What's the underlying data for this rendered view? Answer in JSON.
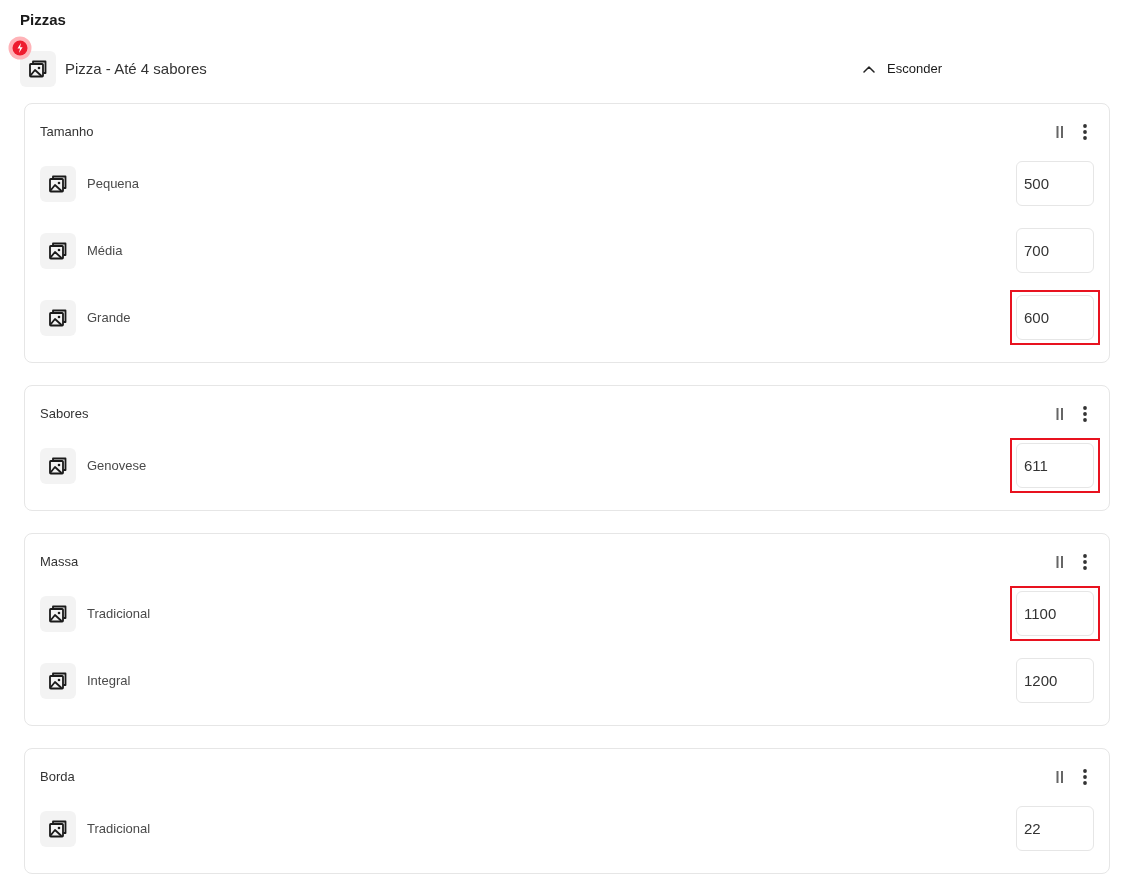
{
  "title": "Pizzas",
  "product": {
    "name": "Pizza - Até 4 sabores"
  },
  "toggle": {
    "label": "Esconder",
    "expanded": true
  },
  "sections": [
    {
      "title": "Tamanho",
      "options": [
        {
          "name": "Pequena",
          "value": "500",
          "highlighted": false
        },
        {
          "name": "Média",
          "value": "700",
          "highlighted": false
        },
        {
          "name": "Grande",
          "value": "600",
          "highlighted": true
        }
      ]
    },
    {
      "title": "Sabores",
      "options": [
        {
          "name": "Genovese",
          "value": "611",
          "highlighted": true
        }
      ]
    },
    {
      "title": "Massa",
      "options": [
        {
          "name": "Tradicional",
          "value": "1100",
          "highlighted": true
        },
        {
          "name": "Integral",
          "value": "1200",
          "highlighted": false
        }
      ]
    },
    {
      "title": "Borda",
      "options": [
        {
          "name": "Tradicional",
          "value": "22",
          "highlighted": false
        }
      ]
    }
  ]
}
